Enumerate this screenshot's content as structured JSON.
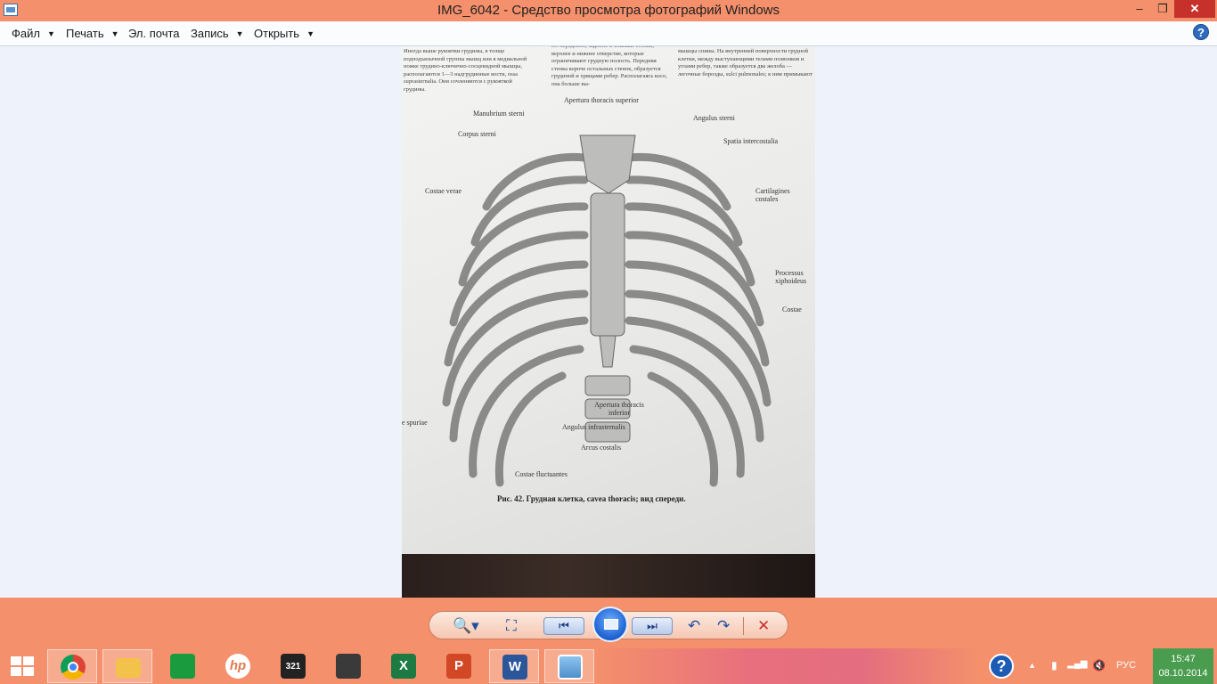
{
  "window": {
    "title": "IMG_6042 - Средство просмотра фотографий Windows",
    "buttons": {
      "minimize": "–",
      "maximize": "❐",
      "close": "✕"
    }
  },
  "menu": {
    "items": [
      {
        "label": "Файл",
        "has_dropdown": true
      },
      {
        "label": "Печать",
        "has_dropdown": true
      },
      {
        "label": "Эл. почта",
        "has_dropdown": false
      },
      {
        "label": "Запись",
        "has_dropdown": true
      },
      {
        "label": "Открыть",
        "has_dropdown": true
      }
    ],
    "help": "?"
  },
  "photo": {
    "text_left": "Иногда выше рукоятки грудины, в толще подподъязычной группы мышц или в медиальной ножке грудино-ключично-сосцевидной мышцы, располагаются 1—3 надгрудинные кости, ossa suprasternalia. Они сочленяются с рукояткой грудины.",
    "text_mid": "ют переднюю, заднюю и боковые стенки, верхнее и нижнее отверстие, которые ограничивают грудную полость. Передняя стенка короче остальных стенок, образуется грудиной и хрящами ребер. Располагаясь косо, она больше вы-",
    "text_right": "мышцы спины. На внутренней поверхности грудной клетки, между выступающими телами позвонков и углами ребер, также образуется два желоба — легочные борозды, sulci pulmonales; к ним примыкают",
    "labels": {
      "apertura_superior": "Apertura thoracis superior",
      "manubrium": "Manubrium sterni",
      "angulus_sterni": "Angulus sterni",
      "corpus": "Corpus sterni",
      "spatia": "Spatia intercostalia",
      "costae_verae": "Costae verae",
      "cartilagines": "Cartilagines costales",
      "processus": "Processus xiphoideus",
      "costae": "Costae",
      "apertura_inferior": "Apertura thoracis inferior",
      "angulus_infra": "Angulus infrasternalis",
      "costae_spuriae": "e spuriae",
      "arcus": "Arcus costalis",
      "fluctuantes": "Costae fluctuantes"
    },
    "caption": "Рис. 42. Грудная клетка, cavea thoracis; вид спереди."
  },
  "controls": {
    "zoom": "🔍▾",
    "fit": "⛶",
    "prev": "⏮",
    "next": "⏭",
    "rotate_left": "↶",
    "rotate_right": "↷",
    "delete": "✕"
  },
  "taskbar": {
    "apps": [
      {
        "name": "chrome",
        "color": "#4caf50"
      },
      {
        "name": "explorer",
        "color": "#f3c24a"
      },
      {
        "name": "store",
        "color": "#1a9c3e"
      },
      {
        "name": "hp",
        "color": "#ffffff"
      },
      {
        "name": "video-player",
        "color": "#333333"
      },
      {
        "name": "touch-app",
        "color": "#444444"
      },
      {
        "name": "excel",
        "color": "#1e7a43"
      },
      {
        "name": "powerpoint",
        "color": "#d24726"
      },
      {
        "name": "word",
        "color": "#2b579a"
      },
      {
        "name": "photo-viewer",
        "color": "#5b9bd5"
      }
    ],
    "tray": {
      "help": "?",
      "chevron": "▲",
      "battery": "▮",
      "signal": "▂▄▆",
      "volume": "🔇",
      "language": "РУС",
      "time": "15:47",
      "date": "08.10.2014"
    }
  }
}
